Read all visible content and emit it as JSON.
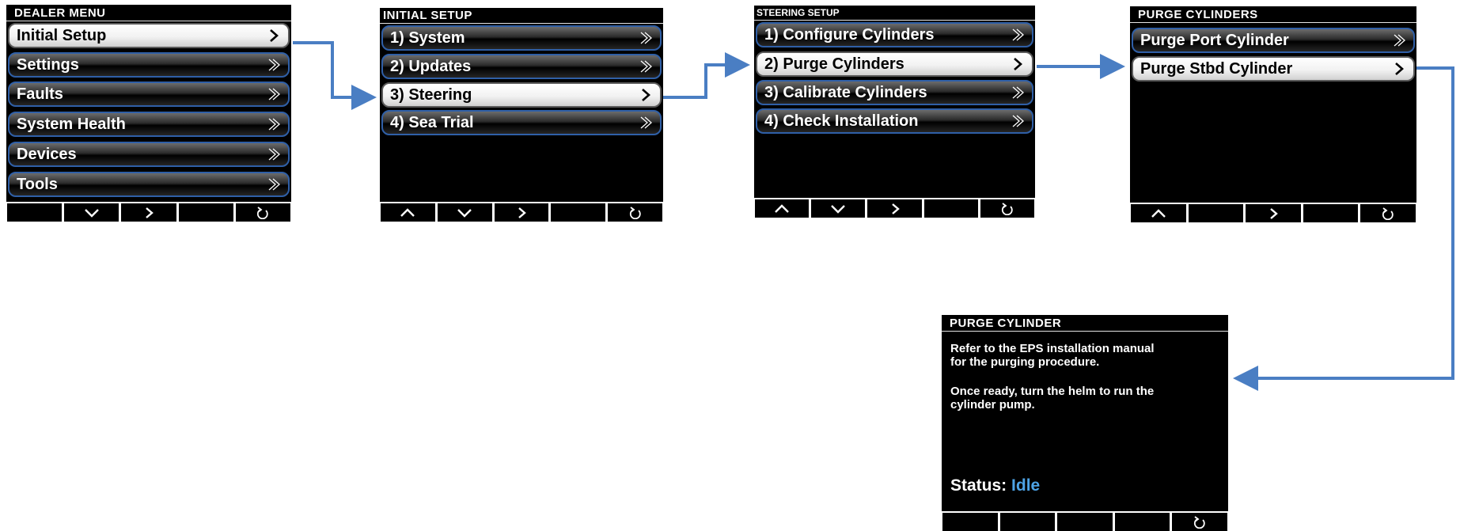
{
  "colors": {
    "arrow": "#4a7ec3",
    "status_value": "#4da3e6",
    "item_border": "#2f5fa7"
  },
  "screens": {
    "dealer_menu": {
      "title": "DEALER MENU",
      "items": [
        "Initial Setup",
        "Settings",
        "Faults",
        "System Health",
        "Devices",
        "Tools"
      ],
      "selected_index": 0,
      "softkeys": [
        "",
        "chevron-down-icon",
        "chevron-right-icon",
        "",
        "back-icon"
      ]
    },
    "initial_setup": {
      "title": "INITIAL SETUP",
      "items": [
        "1) System",
        "2) Updates",
        "3) Steering",
        "4) Sea Trial"
      ],
      "selected_index": 2,
      "softkeys": [
        "chevron-up-icon",
        "chevron-down-icon",
        "chevron-right-icon",
        "",
        "back-icon"
      ]
    },
    "steering_setup": {
      "title": "STEERING SETUP",
      "items": [
        "1) Configure Cylinders",
        "2) Purge Cylinders",
        "3) Calibrate Cylinders",
        "4) Check Installation"
      ],
      "selected_index": 1,
      "softkeys": [
        "chevron-up-icon",
        "chevron-down-icon",
        "chevron-right-icon",
        "",
        "back-icon"
      ]
    },
    "purge_cylinders": {
      "title": "PURGE CYLINDERS",
      "items": [
        "Purge Port Cylinder",
        "Purge Stbd Cylinder"
      ],
      "selected_index": 1,
      "softkeys": [
        "chevron-up-icon",
        "",
        "chevron-right-icon",
        "",
        "back-icon"
      ]
    },
    "purge_cylinder": {
      "title": "PURGE CYLINDER",
      "paragraph1_line1": "Refer to the EPS installation manual",
      "paragraph1_line2": "for the purging procedure.",
      "paragraph2_line1": "Once ready, turn the helm to run the",
      "paragraph2_line2": "cylinder pump.",
      "status_label": "Status:",
      "status_value": "Idle",
      "softkeys": [
        "",
        "",
        "",
        "",
        "back-icon"
      ]
    }
  }
}
